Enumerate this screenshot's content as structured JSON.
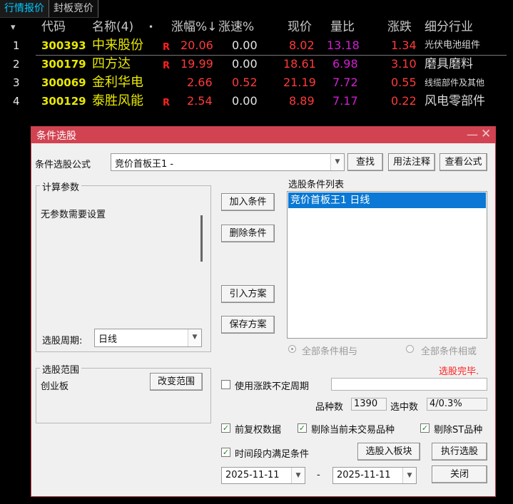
{
  "tabs": [
    "行情报价",
    "封板竞价"
  ],
  "table": {
    "headers": {
      "sort_arrow": "▾",
      "code": "代码",
      "name": "名称(4)",
      "dot": "•",
      "pct": "涨幅%↓",
      "speed": "涨速%",
      "price": "现价",
      "vol_ratio": "量比",
      "change": "涨跌",
      "industry": "细分行业"
    },
    "rows": [
      {
        "idx": "1",
        "code": "300393",
        "name": "中来股份",
        "flag": "R",
        "pct": "20.06",
        "speed": "0.00",
        "price": "8.02",
        "vol_ratio": "13.18",
        "change": "1.34",
        "industry": "光伏电池组件"
      },
      {
        "idx": "2",
        "code": "300179",
        "name": "四方达",
        "flag": "R",
        "pct": "19.99",
        "speed": "0.00",
        "price": "18.61",
        "vol_ratio": "6.98",
        "change": "3.10",
        "industry": "磨具磨料"
      },
      {
        "idx": "3",
        "code": "300069",
        "name": "金利华电",
        "flag": "",
        "pct": "2.66",
        "speed": "0.52",
        "price": "21.19",
        "vol_ratio": "7.72",
        "change": "0.55",
        "industry": "线缆部件及其他"
      },
      {
        "idx": "4",
        "code": "300129",
        "name": "泰胜风能",
        "flag": "R",
        "pct": "2.54",
        "speed": "0.00",
        "price": "8.89",
        "vol_ratio": "7.17",
        "change": "0.22",
        "industry": "风电零部件"
      }
    ]
  },
  "dialog": {
    "title": "条件选股",
    "minimize": "—",
    "close": "✕",
    "formula_label": "条件选股公式",
    "formula_value": "竞价首板王1  -",
    "find_btn": "查找",
    "usage_btn": "用法注释",
    "view_btn": "查看公式",
    "params_group": "计算参数",
    "params_text": "无参数需要设置",
    "period_label": "选股周期:",
    "period_value": "日线",
    "add_btn": "加入条件",
    "del_btn": "删除条件",
    "import_btn": "引入方案",
    "save_btn": "保存方案",
    "cond_list_label": "选股条件列表",
    "cond_items": [
      "竞价首板王1  日线"
    ],
    "radio_and": "全部条件相与",
    "radio_or": "全部条件相或",
    "status": "选股完毕.",
    "range_group": "选股范围",
    "range_value": "创业板",
    "change_range_btn": "改变范围",
    "use_period_label": "使用涨跌不定周期",
    "count_label": "品种数",
    "count_value": "1390",
    "selected_label": "选中数",
    "selected_value": "4/0.3%",
    "opt_adjust": "前复权数据",
    "opt_untraded": "剔除当前未交易品种",
    "opt_st": "剔除ST品种",
    "opt_period": "时间段内满足条件",
    "to_block_btn": "选股入板块",
    "run_btn": "执行选股",
    "date_from": "2025-11-11",
    "date_sep": "-",
    "date_to": "2025-11-11",
    "close_btn": "关闭"
  },
  "colors": {
    "title_bar": "#d24352",
    "selection": "#0a78d4",
    "status_red": "#ff2020",
    "stock_yellow": "#e8e800",
    "up_red": "#ff3a3a",
    "vol_magenta": "#d020d0"
  }
}
